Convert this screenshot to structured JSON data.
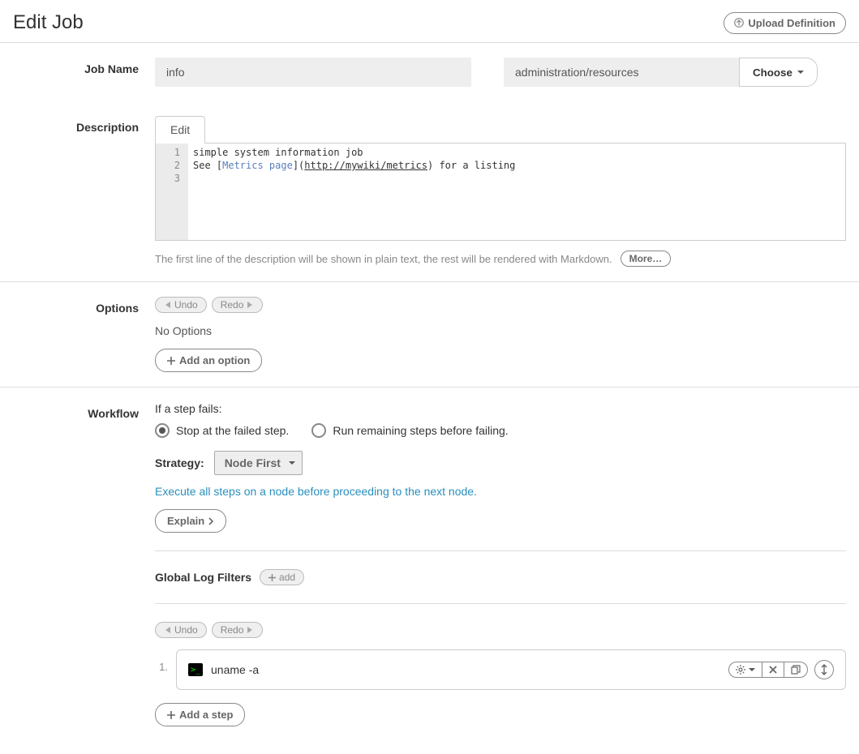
{
  "header": {
    "title": "Edit Job",
    "upload_label": "Upload Definition"
  },
  "jobname": {
    "label": "Job Name",
    "value": "info",
    "group_value": "administration/resources",
    "choose_label": "Choose"
  },
  "description": {
    "label": "Description",
    "tab_edit": "Edit",
    "lines": {
      "l1_num": "1",
      "l2_num": "2",
      "l3_num": "3",
      "l1": "simple system information job",
      "l2": "",
      "l3_pre": "See [",
      "l3_link": "Metrics page",
      "l3_mid": "](",
      "l3_url": "http://mywiki/metrics",
      "l3_post": ") for a listing"
    },
    "hint": "The first line of the description will be shown in plain text, the rest will be rendered with Markdown.",
    "more_label": "More…"
  },
  "options": {
    "label": "Options",
    "undo_label": "Undo",
    "redo_label": "Redo",
    "none": "No Options",
    "add_label": "Add an option"
  },
  "workflow": {
    "label": "Workflow",
    "fail_q": "If a step fails:",
    "opt_stop": "Stop at the failed step.",
    "opt_run": "Run remaining steps before failing.",
    "strategy_label": "Strategy:",
    "strategy_value": "Node First",
    "strategy_desc": "Execute all steps on a node before proceeding to the next node.",
    "explain_label": "Explain",
    "glf_label": "Global Log Filters",
    "glf_add": "add",
    "undo_label": "Undo",
    "redo_label": "Redo",
    "step_num": "1.",
    "step_cmd": "uname -a",
    "add_step_label": "Add a step"
  }
}
